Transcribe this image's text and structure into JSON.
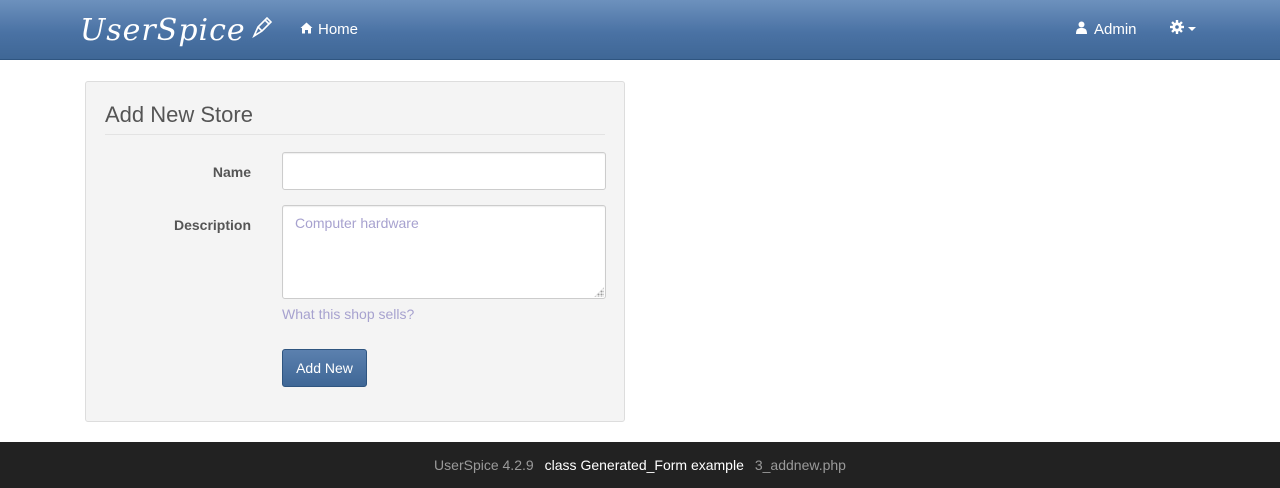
{
  "navbar": {
    "brand": "UserSpice",
    "home_label": "Home",
    "user_label": "Admin",
    "icons": {
      "home": "home-icon",
      "user": "user-icon",
      "settings": "gear-icon",
      "brand": "pen-icon"
    },
    "colors": {
      "navbar_top": "#6d91bd",
      "navbar_bottom": "#3f6796"
    }
  },
  "form": {
    "title": "Add New Store",
    "name_label": "Name",
    "name_value": "",
    "description_label": "Description",
    "description_placeholder": "Computer hardware",
    "description_help": "What this shop sells?",
    "submit_label": "Add New",
    "colors": {
      "panel_bg": "#f4f4f4",
      "button": "#3f6796",
      "hint": "#a7a2cf"
    }
  },
  "footer": {
    "version": "UserSpice 4.2.9",
    "example": "class Generated_Form example",
    "file": "3_addnew.php",
    "colors": {
      "background": "#222222"
    }
  }
}
